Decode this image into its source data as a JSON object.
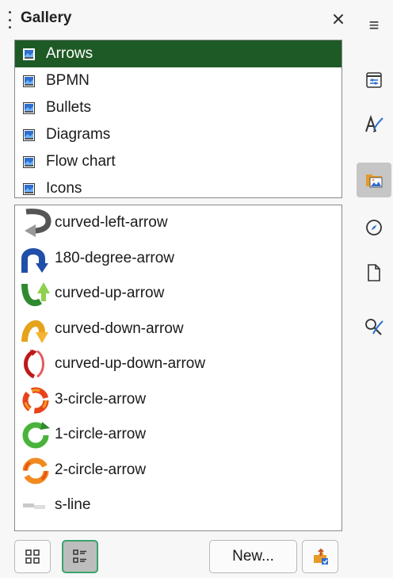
{
  "deck": {
    "title": "Gallery",
    "close_glyph": "✕"
  },
  "themes": [
    {
      "label": "Arrows",
      "selected": true
    },
    {
      "label": "BPMN",
      "selected": false
    },
    {
      "label": "Bullets",
      "selected": false
    },
    {
      "label": "Diagrams",
      "selected": false
    },
    {
      "label": "Flow chart",
      "selected": false
    },
    {
      "label": "Icons",
      "selected": false
    }
  ],
  "items": [
    {
      "label": "curved-left-arrow",
      "icon": "curved-left-arrow-icon"
    },
    {
      "label": "180-degree-arrow",
      "icon": "180-degree-arrow-icon"
    },
    {
      "label": "curved-up-arrow",
      "icon": "curved-up-arrow-icon"
    },
    {
      "label": "curved-down-arrow",
      "icon": "curved-down-arrow-icon"
    },
    {
      "label": "curved-up-down-arrow",
      "icon": "curved-up-down-arrow-icon"
    },
    {
      "label": "3-circle-arrow",
      "icon": "3-circle-arrow-icon"
    },
    {
      "label": "1-circle-arrow",
      "icon": "1-circle-arrow-icon"
    },
    {
      "label": "2-circle-arrow",
      "icon": "2-circle-arrow-icon"
    },
    {
      "label": "s-line",
      "icon": "s-line-icon"
    }
  ],
  "bottom_bar": {
    "new_label": "New...",
    "icon_view": "icon-view-icon",
    "detail_view": "detail-view-icon",
    "properties": "theme-properties-icon"
  },
  "tabbar": {
    "menu_glyph": "≡",
    "tabs": [
      {
        "name": "properties-tab",
        "icon": "sliders-icon",
        "active": false
      },
      {
        "name": "styles-tab",
        "icon": "styles-brush-icon",
        "active": false
      },
      {
        "name": "gallery-tab",
        "icon": "gallery-folder-icon",
        "active": true
      },
      {
        "name": "navigator-tab",
        "icon": "compass-icon",
        "active": false
      },
      {
        "name": "page-tab",
        "icon": "page-icon",
        "active": false
      },
      {
        "name": "style-inspector-tab",
        "icon": "inspector-icon",
        "active": false
      }
    ]
  },
  "colors": {
    "selection": "#1e5a25",
    "accent_green": "#3aa36b",
    "active_tab": "#c6c6c6"
  }
}
